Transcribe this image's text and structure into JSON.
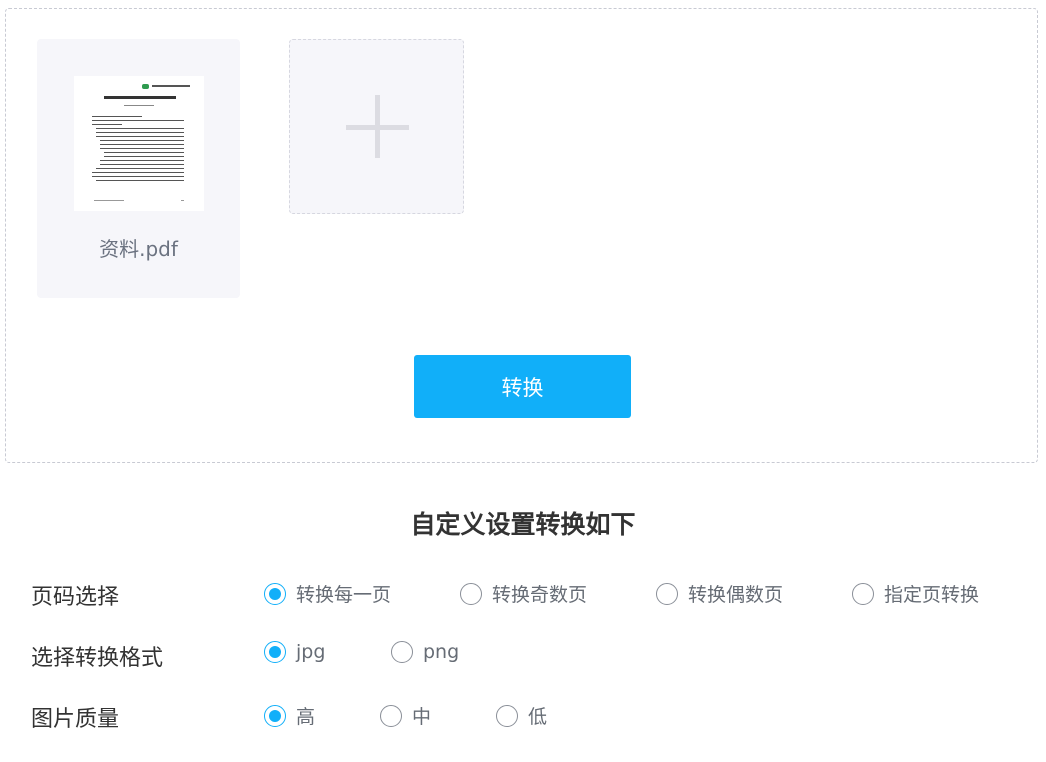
{
  "upload": {
    "file": {
      "name": "资料.pdf",
      "thumbnail_icon": "pdf-page-thumbnail"
    },
    "add_icon": "plus-icon"
  },
  "convert_button": "转换",
  "settings": {
    "title": "自定义设置转换如下",
    "page_selection": {
      "label": "页码选择",
      "options": [
        "转换每一页",
        "转换奇数页",
        "转换偶数页",
        "指定页转换"
      ],
      "selected": "转换每一页"
    },
    "format": {
      "label": "选择转换格式",
      "options": [
        "jpg",
        "png"
      ],
      "selected": "jpg"
    },
    "quality": {
      "label": "图片质量",
      "options": [
        "高",
        "中",
        "低"
      ],
      "selected": "高"
    }
  },
  "colors": {
    "accent": "#11aff9",
    "tile_bg": "#f6f6fa",
    "text_muted": "#666c75"
  }
}
